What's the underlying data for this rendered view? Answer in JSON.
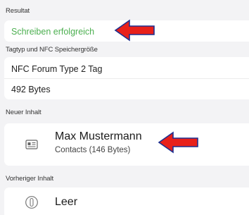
{
  "result": {
    "label": "Resultat",
    "value": "Schreiben erfolgreich",
    "value_color": "#4caf50"
  },
  "tag_info": {
    "label": "Tagtyp und NFC Speichergröße",
    "type": "NFC Forum Type 2 Tag",
    "size": "492 Bytes"
  },
  "new_content": {
    "label": "Neuer Inhalt",
    "icon": "contact-card-icon",
    "title": "Max Mustermann",
    "subtitle": "Contacts (146 Bytes)"
  },
  "previous_content": {
    "label": "Vorheriger Inhalt",
    "icon": "info-circle-icon",
    "title": "Leer"
  },
  "annotation": {
    "arrow_color": "#e8201a",
    "arrow_outline": "#1d2f8f"
  }
}
